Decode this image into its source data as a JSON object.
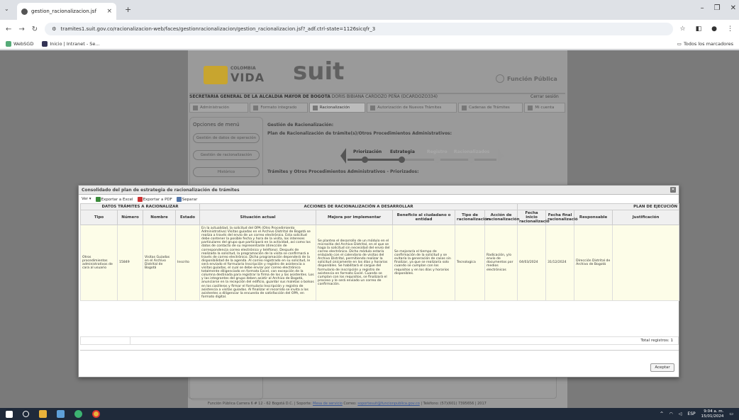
{
  "browser": {
    "tab_title": "gestion_racionalizacion.jsf",
    "url": "tramites1.suit.gov.co/racionalizacion-web/faces/gestionracionalizacion/gestion_racionalizacion.jsf?_adf.ctrl-state=1126sicqfr_3",
    "bookmarks": [
      "WebSGD",
      "Inicio | Intranet - Se..."
    ],
    "bookmarks_right": "Todos los marcadores"
  },
  "site": {
    "logo_co": "COLOMBIA",
    "logo_vida": "VIDA",
    "logo_suit": "suit",
    "logo_fp": "Función Pública",
    "entity": "SECRETARIA GENERAL DE LA ALCALDIA MAYOR DE BOGOTA",
    "user": "DORIS BIBIANA CARDOZO PEÑA (DCARDOZO334)",
    "logout": "Cerrar sesión",
    "menu": [
      "Administración",
      "Formato integrado",
      "Racionalización",
      "Autorización de Nuevos Trámites",
      "Cadenas de Trámites",
      "Mi cuenta"
    ],
    "sidebar_title": "Opciones de menú",
    "sidebar_items": [
      "Gestión de datos de operación",
      "Gestión de racionalización",
      "Histórico"
    ],
    "content_title": "Gestión de Racionalización:",
    "content_sub": "Plan de Racionalización de trámite(s)/Otros Procedimientos Administrativos:",
    "steps": [
      "Priorización",
      "Estrategia",
      "Registro",
      "Racionalizados"
    ],
    "tramites_title": "Trámites y Otros Procedimientos Administrativos - Priorizados:",
    "footer_pre": "Función Pública Carrera 6 # 12 - 62 Bogotá D.C. | Soporte:",
    "footer_link1": "Mesa de servicio",
    "footer_mid": "Correo:",
    "footer_link2": "soportesuit@funcionpublica.gov.co",
    "footer_post": "| Teléfono: (57)(601) 7395656 | 2017"
  },
  "modal": {
    "title": "Consolidado del plan de estrategia de racionalización de trámites",
    "toolbar": [
      "Ver",
      "Exportar a Excel",
      "Exportar a PDF",
      "Separar"
    ],
    "group_headers": [
      "DATOS TRÁMITES A RACIONALIZAR",
      "ACCIONES DE RACIONALIZACIÓN A DESARROLLAR",
      "PLAN DE EJECUCIÓN"
    ],
    "columns": [
      "Tipo",
      "Número",
      "Nombre",
      "Estado",
      "Situación actual",
      "Mejora por implementar",
      "Beneficio al ciudadano o entidad",
      "Tipo de racionalización",
      "Acción de racionalización",
      "Fecha inicio racionalizació",
      "Fecha final racionalizació",
      "Responsable",
      "Justificación"
    ],
    "row": {
      "tipo": "Otros procedimientos administrativos de cara al usuario",
      "numero": "15849",
      "nombre": "Visitas Guiadas en el Archivo Distrital de Bogotá",
      "estado": "Inscrito",
      "situacion": "En la actualidad, la solicitud del OPA (Otro Procedimiento Administrativo) Visitas guiadas en el Archivo Distrital de Bogotá se realiza a través del envío de un correo electrónico. Esta solicitud debe contener la posible fecha y hora de la visita, los intereses particulares del grupo que participará en la actividad, así como los datos de contacto de su representante (dirección de correspondencia correo electrónico y teléfono). Después de realizada la solicitud, la programación de la visita se confirmará a través de correo electrónico. Dicha programación dependerá de la disponibilidad de la agenda. Al correo registrado en su solicitud, le será enviado el formulario Inscripción y registro de asistencia a visitas guiadas, el cual se debe enviar por correo electrónico totalmente diligenciado en formato Excel, con excepción de la columna destinada para registrar la firma de los y las asistentes. Los y las integrantes del grupo deben asistir al Archivo de Bogotá, anunciarse en la recepción del edificio, guardar sus maletas o bolsos en los casilleros y firmar el formulario Inscripción y registro de asistencia a visitas guiadas. Al finalizar el recorrido se invita a los asistentes a diligenciar la encuesta de satisfacción del OPA, en formato digital.",
      "mejora": "Se plantea el desarrollo de un módulo en el micrositio del Archivo Distrital, en el que se haga la solicitud sin necesidad del envío del correo electrónico. Dicho módulo estaría enlazado con el calendario de visitas del Archivo Distrital, permitiendo realizar la solicitud únicamente en los días y horarios disponibles. Se habilitará el cargue del formulario de inscripción y registro de asistencia en formato Excel. Cuando se cumplan con los requisitos, se finalizará el proceso y le será enviado un correo de confirmación.",
      "beneficio": "Se mejoraría el tiempo de confirmación de la solicitud y se evitaría la generación de casos sin finalizar, ya que se realizaría solo cuando se cumplan con los requisitos y en los días y horarios disponibles.",
      "tipo_rac": "Tecnologica",
      "accion": "Radicación, y/o envío de documentos por medios electrónicos",
      "fecha_inicio": "04/03/2024",
      "fecha_final": "31/12/2024",
      "responsable": "Dirección Distrital de Archivo de Bogotá",
      "justificacion": ""
    },
    "total": "Total registros: 1",
    "accept": "Aceptar"
  },
  "taskbar": {
    "lang": "ESP",
    "time": "9:04 a. m.",
    "date": "15/01/2024"
  }
}
